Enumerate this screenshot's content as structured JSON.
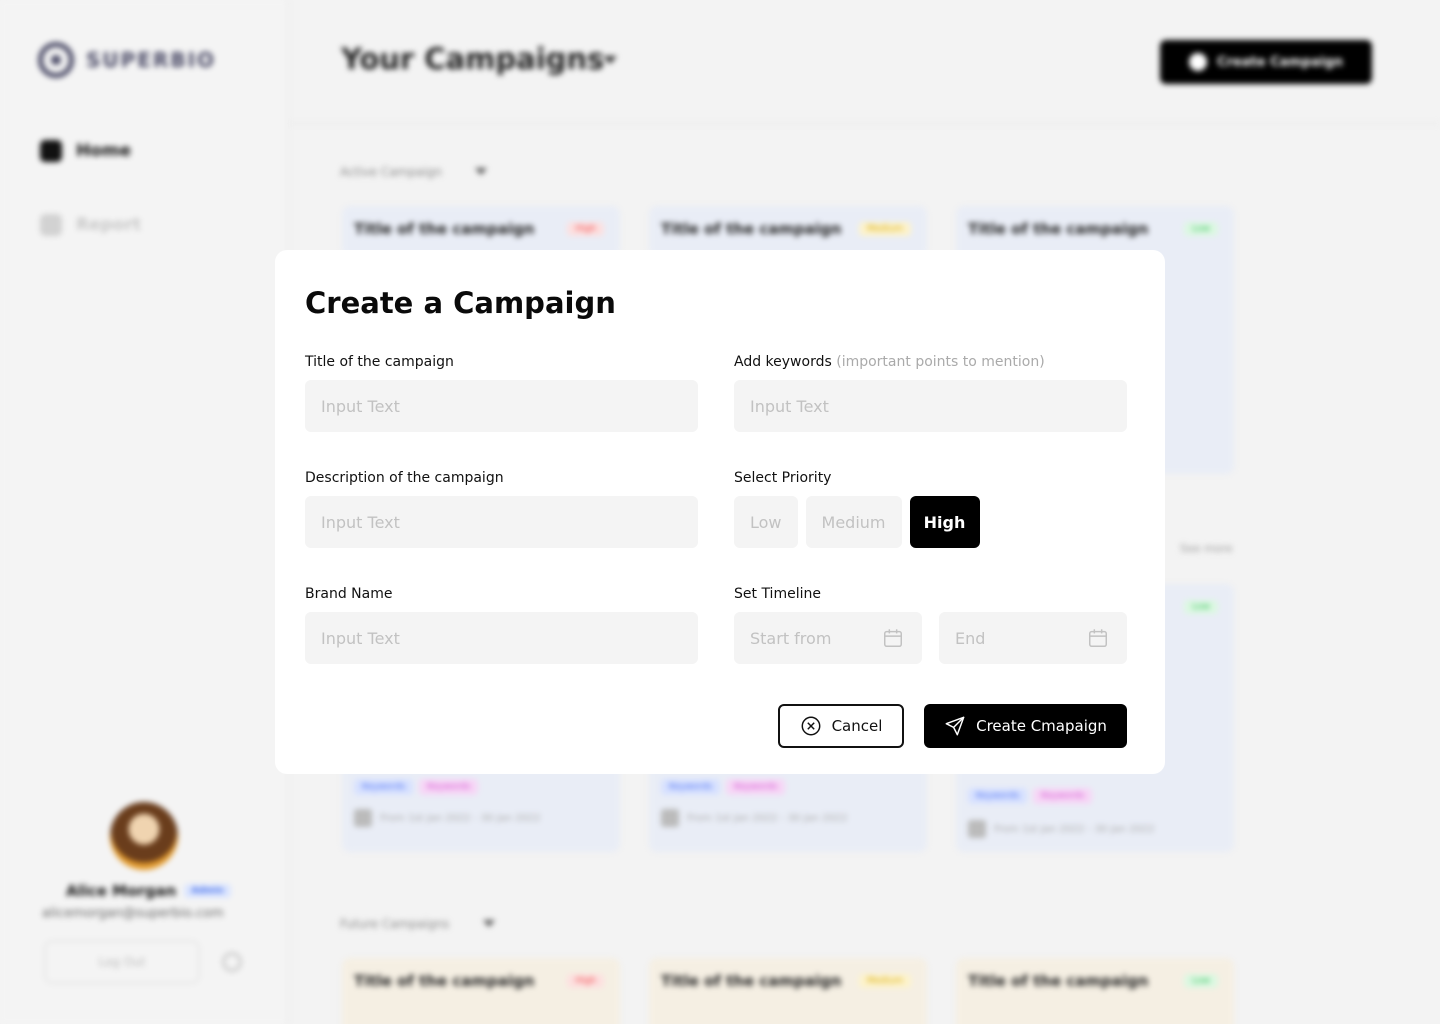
{
  "background": {
    "logo_text": "SUPERBIO",
    "nav": [
      {
        "label": "Home",
        "active": true
      },
      {
        "label": "Report",
        "active": false
      }
    ],
    "user": {
      "name": "Alice Morgan",
      "badge": "Admin",
      "email": "alicemorgan@superbio.com",
      "logout_label": "Log Out"
    },
    "header": {
      "title": "Your Campaigns",
      "create_button": "Create Campaign"
    },
    "sections": {
      "active_label": "Active Campaign",
      "future_label": "Future Campaigns",
      "see_more": "See more"
    },
    "cards": {
      "title": "Title of the campaign",
      "priority_high": "High",
      "priority_medium": "Medium",
      "priority_low": "Low",
      "keyword": "Keywords",
      "timeline": "From 1st Jan 2022 - 30 Jan 2022"
    }
  },
  "modal": {
    "title": "Create a Campaign",
    "fields": {
      "title": {
        "label": "Title of the campaign",
        "placeholder": "Input Text"
      },
      "description": {
        "label": "Description of the campaign",
        "placeholder": "Input Text"
      },
      "brand": {
        "label": "Brand Name",
        "placeholder": "Input Text"
      },
      "keywords": {
        "label": "Add keywords",
        "hint": "(important points to mention)",
        "placeholder": "Input Text"
      }
    },
    "priority": {
      "label": "Select Priority",
      "options": [
        "Low",
        "Medium",
        "High"
      ],
      "selected": "High"
    },
    "timeline": {
      "label": "Set Timeline",
      "start_placeholder": "Start from",
      "end_placeholder": "End"
    },
    "buttons": {
      "cancel": "Cancel",
      "create": "Create Cmapaign"
    }
  }
}
